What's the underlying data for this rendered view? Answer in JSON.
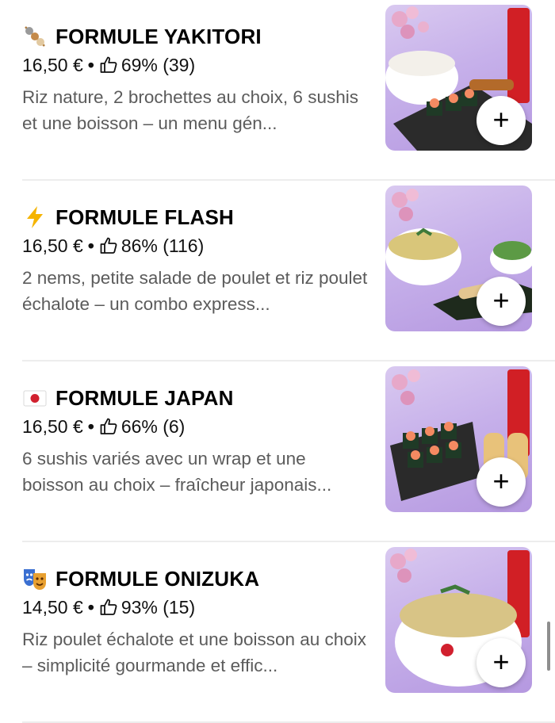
{
  "menu_items": [
    {
      "icon": "skewer-icon",
      "title": "FORMULE YAKITORI",
      "price": "16,50 €",
      "rating": "69% (39)",
      "description": "Riz nature, 2 brochettes au choix, 6 sushis et une boisson – un menu gén..."
    },
    {
      "icon": "lightning-icon",
      "title": "FORMULE FLASH",
      "price": "16,50 €",
      "rating": "86% (116)",
      "description": "2 nems, petite salade de poulet et riz poulet échalote – un combo express..."
    },
    {
      "icon": "japan-flag-icon",
      "title": "FORMULE JAPAN",
      "price": "16,50 €",
      "rating": "66% (6)",
      "description": "6 sushis variés avec un wrap et une boisson au choix – fraîcheur japonais..."
    },
    {
      "icon": "theater-masks-icon",
      "title": "FORMULE ONIZUKA",
      "price": "14,50 €",
      "rating": "93% (15)",
      "description": "Riz poulet échalote et une boisson au choix – simplicité gourmande et effic..."
    }
  ],
  "separator": "•",
  "add_label": "+",
  "colors": {
    "photo_background": "#c6b0ea",
    "text_secondary": "#5b5b5b",
    "text_primary": "#000000"
  }
}
